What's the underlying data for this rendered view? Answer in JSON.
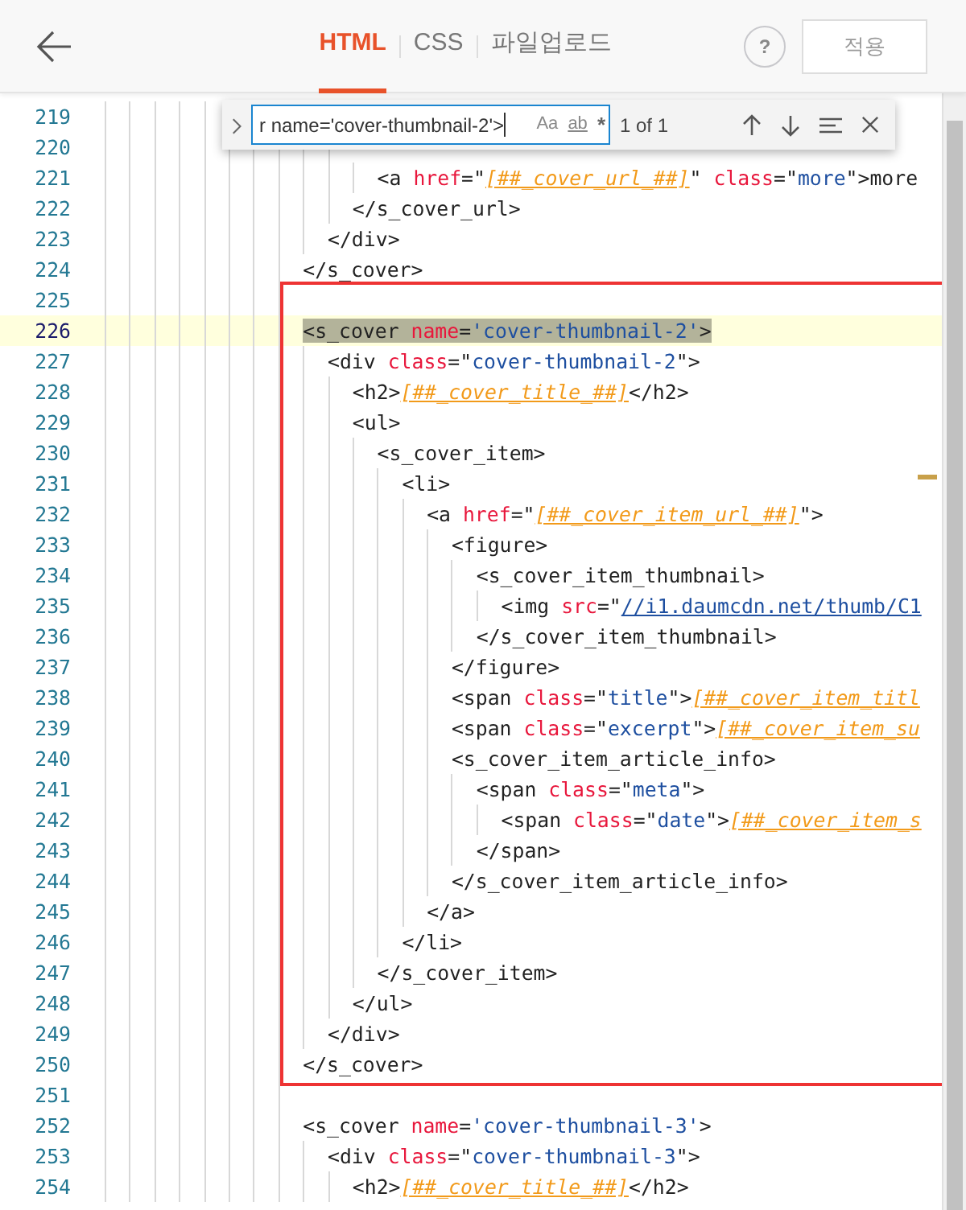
{
  "header": {
    "tabs": [
      {
        "label": "HTML",
        "selected": true
      },
      {
        "label": "CSS",
        "selected": false
      },
      {
        "label": "파일업로드",
        "selected": false
      }
    ],
    "help": "?",
    "apply_button": "적용"
  },
  "find_widget": {
    "value": "r name='cover-thumbnail-2'>",
    "options": [
      "Aa",
      "ab",
      "*"
    ],
    "result": "1 of 1"
  },
  "editor": {
    "lines": [
      {
        "children": [
          {
            "children": [
              {
                "number": "219",
                "current": false
              },
              {
                "number": "220",
                "current": false
              },
              {
                "children": [
                  {
                    "number": "221",
                    "current": false,
                    "tokens": [
                      {
                        "kind": "tag",
                        "text": "<a "
                      },
                      {
                        "kind": "attr",
                        "text": "href"
                      },
                      {
                        "kind": "tag",
                        "text": "=\""
                      },
                      {
                        "kind": "var",
                        "text": "[##_cover_url_##]"
                      },
                      {
                        "kind": "tag",
                        "text": "\" "
                      },
                      {
                        "kind": "attr",
                        "text": "class"
                      },
                      {
                        "kind": "tag",
                        "text": "=\""
                      },
                      {
                        "kind": "str",
                        "text": "more"
                      },
                      {
                        "kind": "tag",
                        "text": "\">more"
                      }
                    ]
                  }
                ]
              },
              {
                "number": "222",
                "current": false,
                "tokens": [
                  {
                    "kind": "tag",
                    "text": "</s_cover_url>"
                  }
                ]
              }
            ]
          },
          {
            "number": "223",
            "current": false,
            "tokens": [
              {
                "kind": "tag",
                "text": "</div>"
              }
            ]
          }
        ]
      },
      {
        "number": "224",
        "current": false,
        "tokens": [
          {
            "kind": "tag",
            "text": "</s_cover>"
          }
        ]
      },
      {
        "number": "225",
        "current": false
      },
      {
        "number": "226",
        "current": true,
        "tokens": [
          {
            "kind": "tag",
            "text": "<s_cover ",
            "match": true
          },
          {
            "kind": "attr",
            "text": "name",
            "match": true
          },
          {
            "kind": "tag",
            "text": "=",
            "match": true
          },
          {
            "kind": "str",
            "text": "'cover-thumbnail-2'",
            "match": true
          },
          {
            "kind": "tag",
            "text": ">",
            "match": true
          }
        ],
        "children": [
          {
            "number": "227",
            "current": false,
            "tokens": [
              {
                "kind": "tag",
                "text": "<div "
              },
              {
                "kind": "attr",
                "text": "class"
              },
              {
                "kind": "tag",
                "text": "=\""
              },
              {
                "kind": "str",
                "text": "cover-thumbnail-2"
              },
              {
                "kind": "tag",
                "text": "\">"
              }
            ],
            "children": [
              {
                "number": "228",
                "current": false,
                "tokens": [
                  {
                    "kind": "tag",
                    "text": "<h2>"
                  },
                  {
                    "kind": "var",
                    "text": "[##_cover_title_##]"
                  },
                  {
                    "kind": "tag",
                    "text": "</h2>"
                  }
                ]
              },
              {
                "number": "229",
                "current": false,
                "tokens": [
                  {
                    "kind": "tag",
                    "text": "<ul>"
                  }
                ],
                "children": [
                  {
                    "number": "230",
                    "current": false,
                    "tokens": [
                      {
                        "kind": "tag",
                        "text": "<s_cover_item>"
                      }
                    ],
                    "children": [
                      {
                        "number": "231",
                        "current": false,
                        "tokens": [
                          {
                            "kind": "tag",
                            "text": "<li>"
                          }
                        ],
                        "children": [
                          {
                            "number": "232",
                            "current": false,
                            "tokens": [
                              {
                                "kind": "tag",
                                "text": "<a "
                              },
                              {
                                "kind": "attr",
                                "text": "href"
                              },
                              {
                                "kind": "tag",
                                "text": "=\""
                              },
                              {
                                "kind": "var",
                                "text": "[##_cover_item_url_##]"
                              },
                              {
                                "kind": "tag",
                                "text": "\">"
                              }
                            ],
                            "children": [
                              {
                                "number": "233",
                                "current": false,
                                "tokens": [
                                  {
                                    "kind": "tag",
                                    "text": "<figure>"
                                  }
                                ],
                                "children": [
                                  {
                                    "number": "234",
                                    "current": false,
                                    "tokens": [
                                      {
                                        "kind": "tag",
                                        "text": "<s_cover_item_thumbnail>"
                                      }
                                    ],
                                    "children": [
                                      {
                                        "number": "235",
                                        "current": false,
                                        "tokens": [
                                          {
                                            "kind": "tag",
                                            "text": "<img "
                                          },
                                          {
                                            "kind": "attr",
                                            "text": "src"
                                          },
                                          {
                                            "kind": "tag",
                                            "text": "=\""
                                          },
                                          {
                                            "kind": "url",
                                            "text": "//i1.daumcdn.net/thumb/C1"
                                          }
                                        ]
                                      }
                                    ]
                                  },
                                  {
                                    "number": "236",
                                    "current": false,
                                    "tokens": [
                                      {
                                        "kind": "tag",
                                        "text": "</s_cover_item_thumbnail>"
                                      }
                                    ]
                                  }
                                ]
                              },
                              {
                                "number": "237",
                                "current": false,
                                "tokens": [
                                  {
                                    "kind": "tag",
                                    "text": "</figure>"
                                  }
                                ]
                              },
                              {
                                "number": "238",
                                "current": false,
                                "tokens": [
                                  {
                                    "kind": "tag",
                                    "text": "<span "
                                  },
                                  {
                                    "kind": "attr",
                                    "text": "class"
                                  },
                                  {
                                    "kind": "tag",
                                    "text": "=\""
                                  },
                                  {
                                    "kind": "str",
                                    "text": "title"
                                  },
                                  {
                                    "kind": "tag",
                                    "text": "\">"
                                  },
                                  {
                                    "kind": "var",
                                    "text": "[##_cover_item_titl"
                                  }
                                ]
                              },
                              {
                                "number": "239",
                                "current": false,
                                "tokens": [
                                  {
                                    "kind": "tag",
                                    "text": "<span "
                                  },
                                  {
                                    "kind": "attr",
                                    "text": "class"
                                  },
                                  {
                                    "kind": "tag",
                                    "text": "=\""
                                  },
                                  {
                                    "kind": "str",
                                    "text": "excerpt"
                                  },
                                  {
                                    "kind": "tag",
                                    "text": "\">"
                                  },
                                  {
                                    "kind": "var",
                                    "text": "[##_cover_item_su"
                                  }
                                ]
                              },
                              {
                                "number": "240",
                                "current": false,
                                "tokens": [
                                  {
                                    "kind": "tag",
                                    "text": "<s_cover_item_article_info>"
                                  }
                                ],
                                "children": [
                                  {
                                    "number": "241",
                                    "current": false,
                                    "tokens": [
                                      {
                                        "kind": "tag",
                                        "text": "<span "
                                      },
                                      {
                                        "kind": "attr",
                                        "text": "class"
                                      },
                                      {
                                        "kind": "tag",
                                        "text": "=\""
                                      },
                                      {
                                        "kind": "str",
                                        "text": "meta"
                                      },
                                      {
                                        "kind": "tag",
                                        "text": "\">"
                                      }
                                    ],
                                    "children": [
                                      {
                                        "number": "242",
                                        "current": false,
                                        "tokens": [
                                          {
                                            "kind": "tag",
                                            "text": "<span "
                                          },
                                          {
                                            "kind": "attr",
                                            "text": "class"
                                          },
                                          {
                                            "kind": "tag",
                                            "text": "=\""
                                          },
                                          {
                                            "kind": "str",
                                            "text": "date"
                                          },
                                          {
                                            "kind": "tag",
                                            "text": "\">"
                                          },
                                          {
                                            "kind": "var",
                                            "text": "[##_cover_item_s"
                                          }
                                        ]
                                      }
                                    ]
                                  },
                                  {
                                    "number": "243",
                                    "current": false,
                                    "tokens": [
                                      {
                                        "kind": "tag",
                                        "text": "</span>"
                                      }
                                    ]
                                  }
                                ]
                              },
                              {
                                "number": "244",
                                "current": false,
                                "tokens": [
                                  {
                                    "kind": "tag",
                                    "text": "</s_cover_item_article_info>"
                                  }
                                ]
                              }
                            ]
                          },
                          {
                            "number": "245",
                            "current": false,
                            "tokens": [
                              {
                                "kind": "tag",
                                "text": "</a>"
                              }
                            ]
                          }
                        ]
                      },
                      {
                        "number": "246",
                        "current": false,
                        "tokens": [
                          {
                            "kind": "tag",
                            "text": "</li>"
                          }
                        ]
                      }
                    ]
                  },
                  {
                    "number": "247",
                    "current": false,
                    "tokens": [
                      {
                        "kind": "tag",
                        "text": "</s_cover_item>"
                      }
                    ]
                  }
                ]
              },
              {
                "number": "248",
                "current": false,
                "tokens": [
                  {
                    "kind": "tag",
                    "text": "</ul>"
                  }
                ]
              }
            ]
          },
          {
            "number": "249",
            "current": false,
            "tokens": [
              {
                "kind": "tag",
                "text": "</div>"
              }
            ]
          }
        ]
      },
      {
        "number": "250",
        "current": false,
        "tokens": [
          {
            "kind": "tag",
            "text": "</s_cover>"
          }
        ]
      },
      {
        "number": "251",
        "current": false
      },
      {
        "number": "252",
        "current": false,
        "tokens": [
          {
            "kind": "tag",
            "text": "<s_cover "
          },
          {
            "kind": "attr",
            "text": "name"
          },
          {
            "kind": "tag",
            "text": "="
          },
          {
            "kind": "str",
            "text": "'cover-thumbnail-3'"
          },
          {
            "kind": "tag",
            "text": ">"
          }
        ],
        "children": [
          {
            "number": "253",
            "current": false,
            "tokens": [
              {
                "kind": "tag",
                "text": "<div "
              },
              {
                "kind": "attr",
                "text": "class"
              },
              {
                "kind": "tag",
                "text": "=\""
              },
              {
                "kind": "str",
                "text": "cover-thumbnail-3"
              },
              {
                "kind": "tag",
                "text": "\">"
              }
            ],
            "children": [
              {
                "number": "254",
                "current": false,
                "tokens": [
                  {
                    "kind": "tag",
                    "text": "<h2>"
                  },
                  {
                    "kind": "var",
                    "text": "[##_cover_title_##]"
                  },
                  {
                    "kind": "tag",
                    "text": "</h2>"
                  }
                ]
              }
            ]
          }
        ]
      }
    ]
  }
}
